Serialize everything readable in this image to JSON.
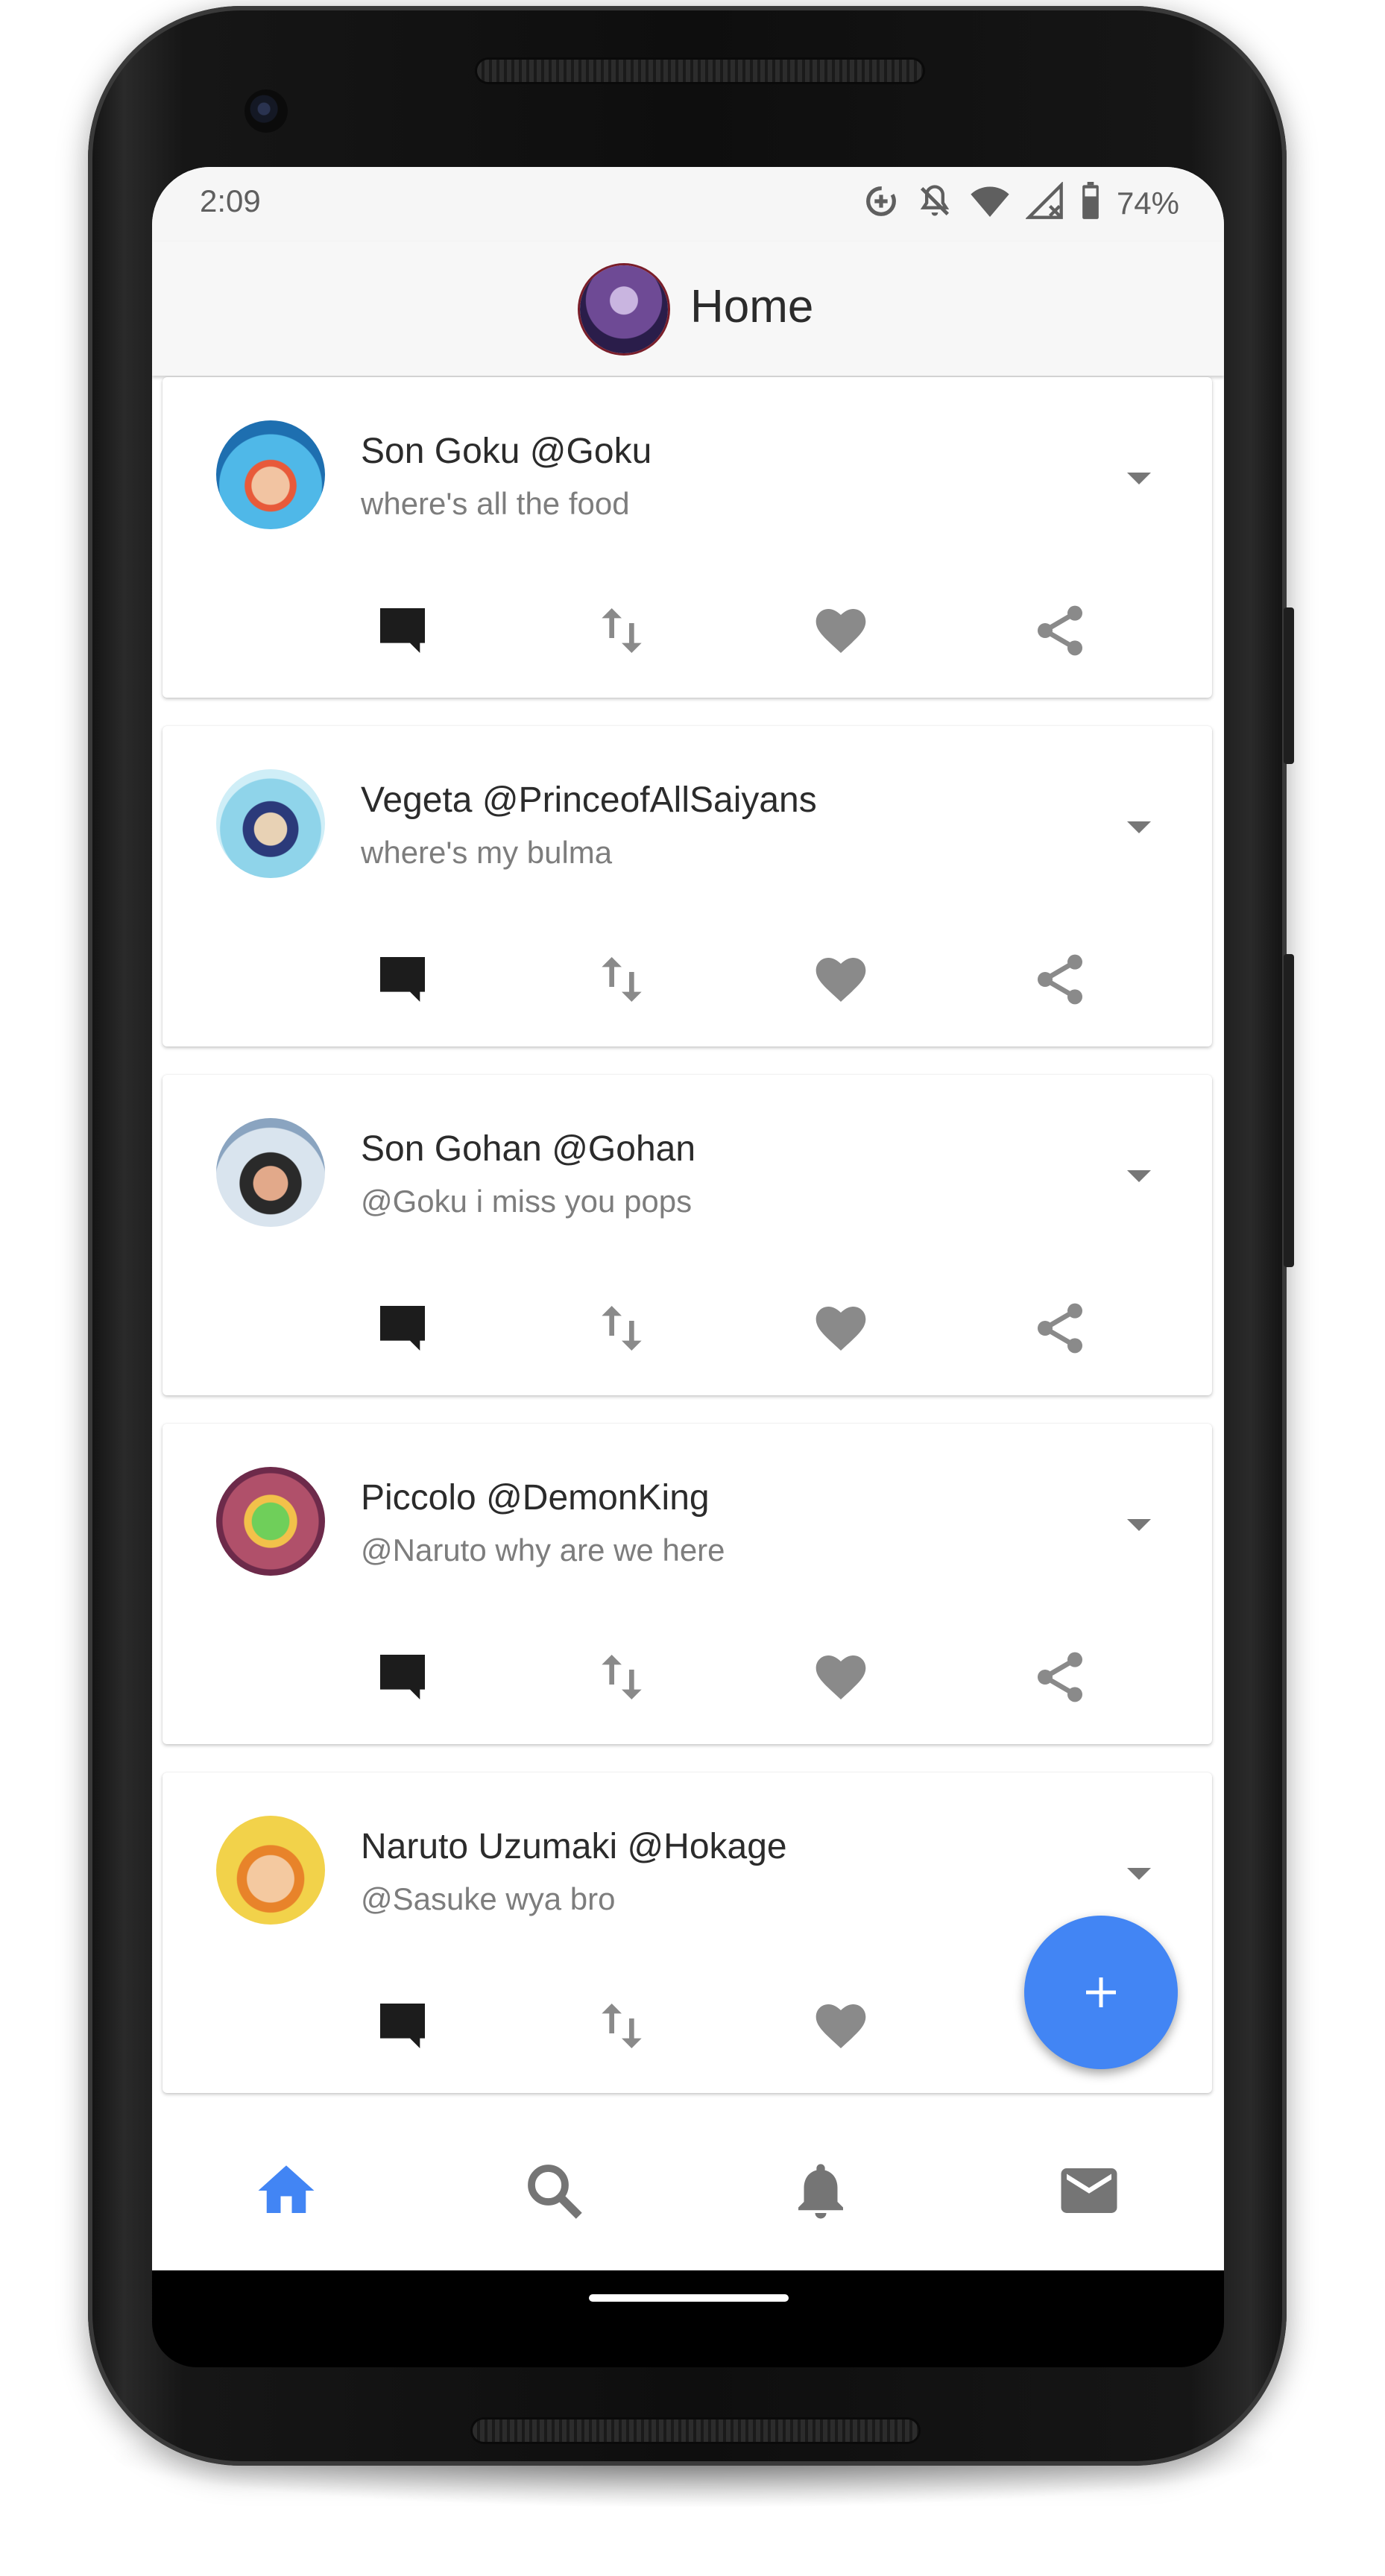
{
  "status_bar": {
    "time": "2:09",
    "battery": "74%",
    "icons": [
      "data-saver-icon",
      "notifications-off-icon",
      "wifi-icon",
      "signal-icon",
      "battery-icon"
    ]
  },
  "app_bar": {
    "title": "Home",
    "avatar_icon": "user-avatar"
  },
  "posts": [
    {
      "name": "Son Goku @Goku",
      "text": "where's all the food",
      "avatar": "goku-avatar"
    },
    {
      "name": "Vegeta @PrinceofAllSaiyans",
      "text": "where's my bulma",
      "avatar": "vegeta-avatar"
    },
    {
      "name": "Son Gohan @Gohan",
      "text": "@Goku i miss you pops",
      "avatar": "gohan-avatar"
    },
    {
      "name": "Piccolo @DemonKing",
      "text": "@Naruto why are we here",
      "avatar": "piccolo-avatar"
    },
    {
      "name": "Naruto Uzumaki @Hokage",
      "text": "@Sasuke wya bro",
      "avatar": "naruto-avatar"
    }
  ],
  "post_actions": [
    "comment-icon",
    "retweet-icon",
    "heart-icon",
    "share-icon"
  ],
  "fab": {
    "icon": "plus-icon"
  },
  "bottom_nav": {
    "items": [
      "home-icon",
      "search-icon",
      "bell-icon",
      "mail-icon"
    ],
    "active": "home-icon"
  },
  "colors": {
    "accent": "#4285f4",
    "text_primary": "#2b2b2b",
    "text_secondary": "#7d7d7d",
    "icon_grey": "#8a8a8a",
    "icon_dark": "#1c1c1c"
  }
}
